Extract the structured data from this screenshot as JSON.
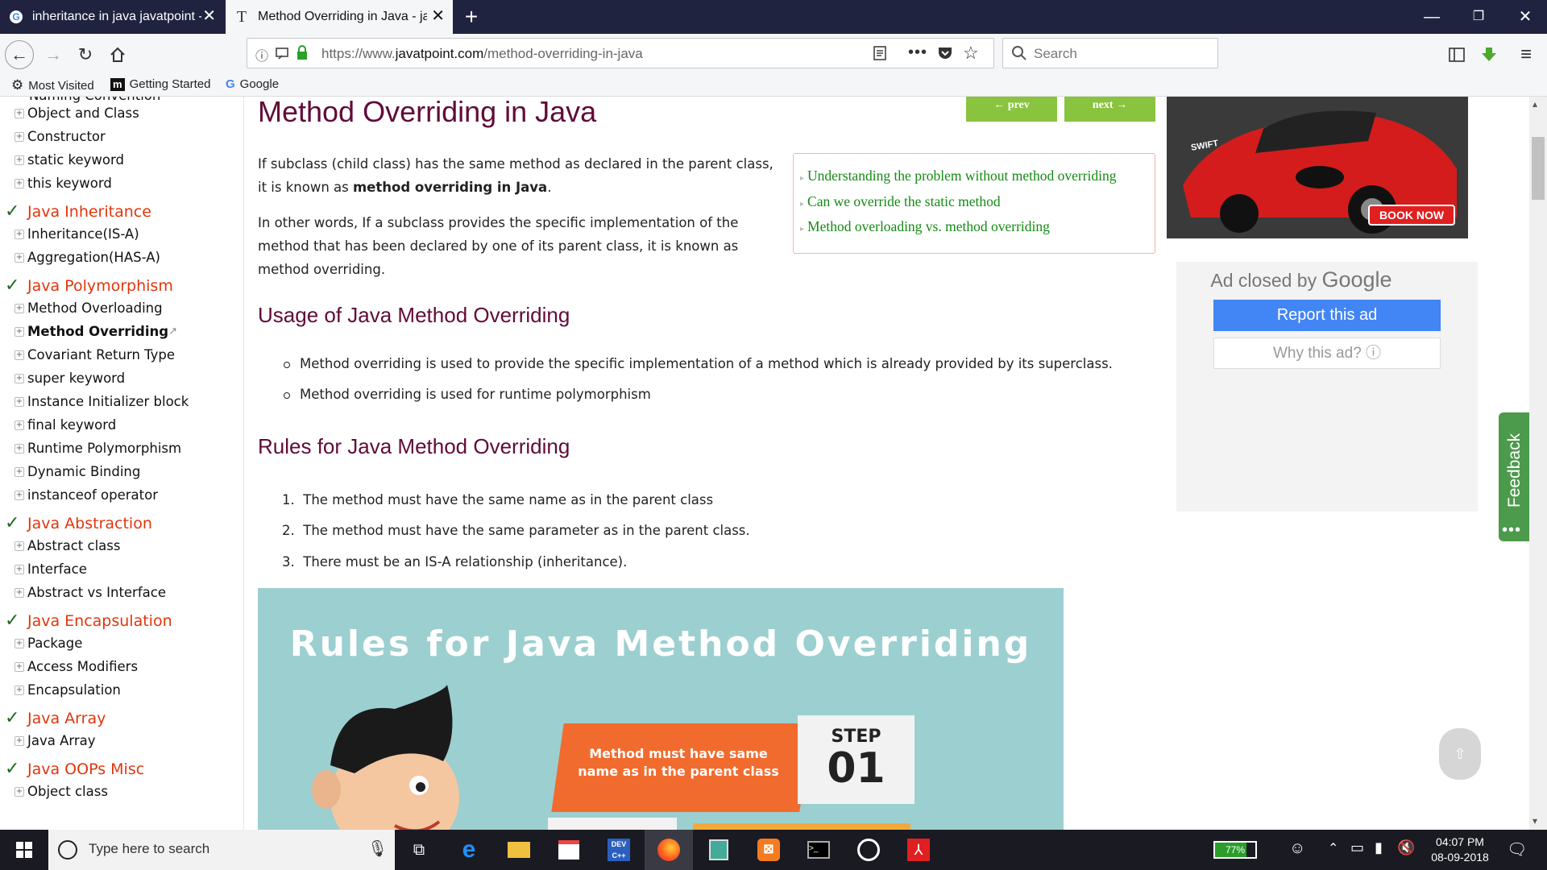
{
  "browser": {
    "tabs": [
      {
        "title": "inheritance in java javatpoint -",
        "active": false
      },
      {
        "title": "Method Overriding in Java - jav",
        "active": true
      }
    ],
    "url_prefix": "https://www.",
    "url_domain": "javatpoint.com",
    "url_path": "/method-overriding-in-java",
    "search_placeholder": "Search",
    "bookmarks": [
      "Most Visited",
      "Getting Started",
      "Google"
    ]
  },
  "sidebar": {
    "cut_top": "Naming Convention",
    "items": [
      {
        "type": "item",
        "label": "Object and Class"
      },
      {
        "type": "item",
        "label": "Constructor"
      },
      {
        "type": "item",
        "label": "static keyword"
      },
      {
        "type": "item",
        "label": "this keyword"
      },
      {
        "type": "head",
        "label": "Java Inheritance"
      },
      {
        "type": "item",
        "label": "Inheritance(IS-A)"
      },
      {
        "type": "item",
        "label": "Aggregation(HAS-A)"
      },
      {
        "type": "head",
        "label": "Java Polymorphism"
      },
      {
        "type": "item",
        "label": "Method Overloading"
      },
      {
        "type": "item",
        "label": "Method Overriding",
        "current": true
      },
      {
        "type": "item",
        "label": "Covariant Return Type"
      },
      {
        "type": "item",
        "label": "super keyword"
      },
      {
        "type": "item",
        "label": "Instance Initializer block"
      },
      {
        "type": "item",
        "label": "final keyword"
      },
      {
        "type": "item",
        "label": "Runtime Polymorphism"
      },
      {
        "type": "item",
        "label": "Dynamic Binding"
      },
      {
        "type": "item",
        "label": "instanceof operator"
      },
      {
        "type": "head",
        "label": "Java Abstraction"
      },
      {
        "type": "item",
        "label": "Abstract class"
      },
      {
        "type": "item",
        "label": "Interface"
      },
      {
        "type": "item",
        "label": "Abstract vs Interface"
      },
      {
        "type": "head",
        "label": "Java Encapsulation"
      },
      {
        "type": "item",
        "label": "Package"
      },
      {
        "type": "item",
        "label": "Access Modifiers"
      },
      {
        "type": "item",
        "label": "Encapsulation"
      },
      {
        "type": "head",
        "label": "Java Array"
      },
      {
        "type": "item",
        "label": "Java Array"
      },
      {
        "type": "head",
        "label": "Java OOPs Misc"
      },
      {
        "type": "item",
        "label": "Object class"
      }
    ]
  },
  "main": {
    "title": "Method Overriding in Java",
    "prev_label": "← prev",
    "next_label": "next →",
    "intro_1a": "If subclass (child class) has the same method as declared in the parent class,",
    "intro_1b": "it is known as ",
    "intro_1_bold": "method overriding in Java",
    "intro_1_end": ".",
    "intro_2_lines": [
      "In other words, If a subclass provides the specific implementation of the",
      "method that has been declared by one of its parent class, it is known as",
      "method overriding."
    ],
    "toc": [
      "Understanding the problem without method overriding",
      "Can we override the static method",
      "Method overloading vs. method overriding"
    ],
    "usage_heading": "Usage of Java Method Overriding",
    "usage_items": [
      "Method overriding is used to provide the specific implementation of a method which is already provided by its superclass.",
      "Method overriding is used for runtime polymorphism"
    ],
    "rules_heading": "Rules for Java Method Overriding",
    "rules_items": [
      "The method must have the same name as in the parent class",
      "The method must have the same parameter as in the parent class.",
      "There must be an IS-A relationship (inheritance)."
    ],
    "infographic": {
      "title": "Rules for Java Method Overriding",
      "step_text_1": "Method must have same",
      "step_text_2": "name as in the parent class",
      "step_label": "STEP",
      "step_number": "01"
    }
  },
  "ads": {
    "car_badge": "SWIFT",
    "book_now": "BOOK NOW",
    "closed_prefix": "Ad closed by ",
    "closed_brand": "Google",
    "report": "Report this ad",
    "why": "Why this ad? ⓘ",
    "feedback": "Feedback"
  },
  "taskbar": {
    "search_placeholder": "Type here to search",
    "battery": "77%",
    "time": "04:07 PM",
    "date": "08-09-2018"
  }
}
